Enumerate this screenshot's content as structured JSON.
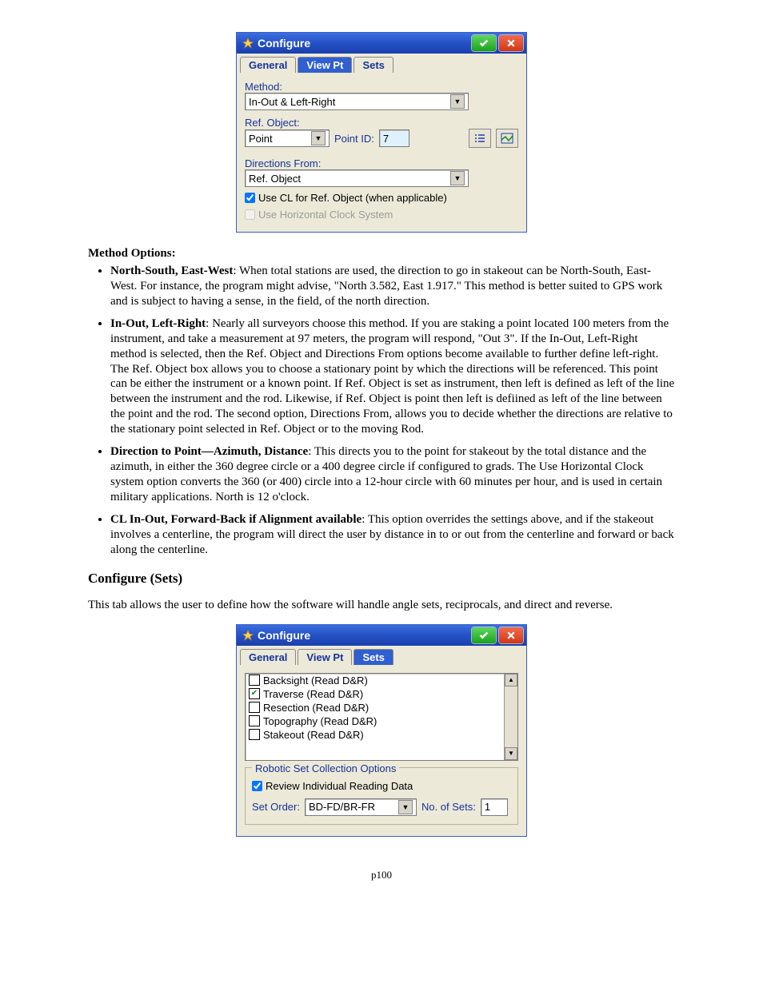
{
  "dialog1": {
    "title": "Configure",
    "icon": "configure-icon",
    "tabs": {
      "general": "General",
      "viewpt": "View Pt",
      "sets": "Sets",
      "active": "viewpt"
    },
    "method_label": "Method:",
    "method_value": "In-Out & Left-Right",
    "refobj_label": "Ref. Object:",
    "refobj_value": "Point",
    "pointid_label": "Point ID:",
    "pointid_value": "7",
    "dirfrom_label": "Directions From:",
    "dirfrom_value": "Ref. Object",
    "use_cl_label": "Use CL for Ref. Object (when applicable)",
    "use_cl_checked": true,
    "use_hclock_label": "Use Horizontal Clock System",
    "use_hclock_checked": false
  },
  "doc": {
    "method_options_heading": "Method Options:",
    "bullets": [
      {
        "lead": "North-South, East-West",
        "text": ": When total stations are used, the direction to go in stakeout can be North-South, East-West.  For instance, the program might advise, \"North 3.582, East 1.917.\"  This method is better suited to GPS work and is subject to having a sense, in the field, of the north direction."
      },
      {
        "lead": "In-Out, Left-Right",
        "text": ": Nearly all surveyors choose this method.  If you are staking a point located 100 meters from the instrument, and take a measurement at 97 meters, the program will respond, \"Out 3\". If the In-Out, Left-Right method is selected, then the Ref. Object and Directions From options become available to further define left-right. The Ref. Object box allows you to choose a stationary point by which the directions will be referenced.  This point can be either the instrument or a known point.  If Ref. Object is set as instrument, then left is defined as left of the line between the instrument and the rod.  Likewise, if Ref. Object is point then left is defiined as left of the line between the point and the rod.  The second option, Directions From, allows you to decide whether the directions are relative to the stationary point selected in Ref. Object or to the moving Rod."
      },
      {
        "lead": "Direction to Point—Azimuth, Distance",
        "text": ": This directs you to the point for stakeout by the total distance and the azimuth, in either the 360 degree circle or a 400 degree circle if configured to grads. The Use Horizontal Clock system option converts the 360 (or 400) circle into a 12-hour circle with 60 minutes per hour, and is used in certain military applications.  North is 12 o'clock."
      },
      {
        "lead": "CL In-Out, Forward-Back if Alignment available",
        "text": ":  This option overrides the settings above, and if the stakeout involves a centerline, the program will direct the user by distance in to or out from the centerline and forward or back along the centerline."
      }
    ],
    "sets_heading": "Configure (Sets)",
    "sets_intro": "This tab allows the user to define how the software will handle angle sets, reciprocals, and direct and reverse.",
    "page": "p100"
  },
  "dialog2": {
    "title": "Configure",
    "tabs": {
      "general": "General",
      "viewpt": "View Pt",
      "sets": "Sets",
      "active": "sets"
    },
    "items": [
      {
        "label": "Backsight (Read D&R)",
        "checked": false
      },
      {
        "label": "Traverse (Read D&R)",
        "checked": true
      },
      {
        "label": "Resection (Read D&R)",
        "checked": false
      },
      {
        "label": "Topography (Read D&R)",
        "checked": false
      },
      {
        "label": "Stakeout (Read D&R)",
        "checked": false
      }
    ],
    "group_title": "Robotic Set Collection Options",
    "review_label": "Review Individual Reading Data",
    "review_checked": true,
    "setorder_label": "Set Order:",
    "setorder_value": "BD-FD/BR-FR",
    "nosets_label": "No. of Sets:",
    "nosets_value": "1"
  }
}
